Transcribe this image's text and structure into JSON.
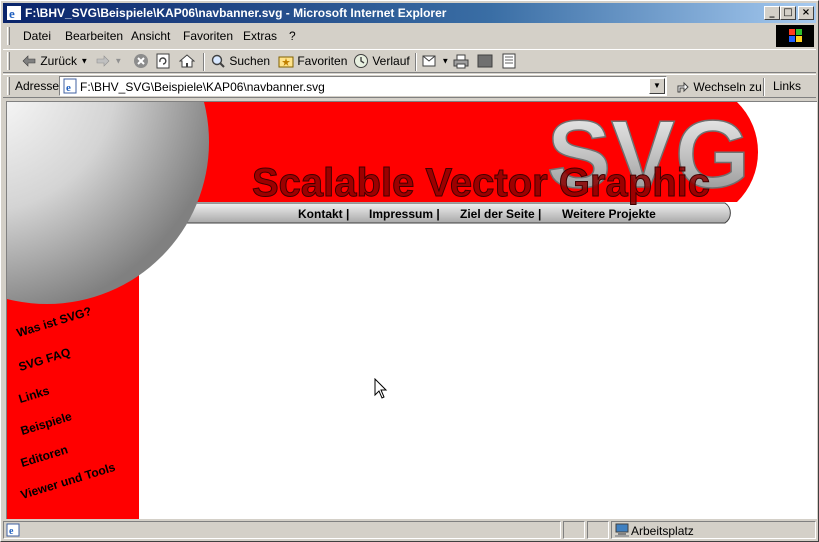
{
  "window": {
    "title": "F:\\BHV_SVG\\Beispiele\\KAP06\\navbanner.svg - Microsoft Internet Explorer",
    "controls": {
      "minimize": "_",
      "maximize": "□",
      "close": "×"
    }
  },
  "menu": {
    "items": [
      {
        "label": "Datei"
      },
      {
        "label": "Bearbeiten"
      },
      {
        "label": "Ansicht"
      },
      {
        "label": "Favoriten"
      },
      {
        "label": "Extras"
      },
      {
        "label": "?"
      }
    ]
  },
  "toolbar": {
    "back_label": "Zurück",
    "search_label": "Suchen",
    "favorites_label": "Favoriten",
    "history_label": "Verlauf"
  },
  "address": {
    "label": "Adresse",
    "url": "F:\\BHV_SVG\\Beispiele\\KAP06\\navbanner.svg",
    "go_label": "Wechseln zu",
    "links_label": "Links"
  },
  "banner": {
    "svg_logo": "SVG",
    "heading": "Scalable Vector Graphic",
    "top_nav": [
      {
        "label": "Kontakt |"
      },
      {
        "label": "Impressum |"
      },
      {
        "label": "Ziel der Seite |"
      },
      {
        "label": "Weitere Projekte"
      }
    ],
    "side_nav": [
      {
        "label": "Was ist SVG?"
      },
      {
        "label": "SVG FAQ"
      },
      {
        "label": "Links"
      },
      {
        "label": "Beispiele"
      },
      {
        "label": "Editoren"
      },
      {
        "label": "Viewer und Tools"
      }
    ],
    "colors": {
      "red": "#ff0000",
      "dark_red": "#8b0000",
      "silver": "#c0c0c0"
    }
  },
  "status": {
    "zone_label": "Arbeitsplatz"
  }
}
